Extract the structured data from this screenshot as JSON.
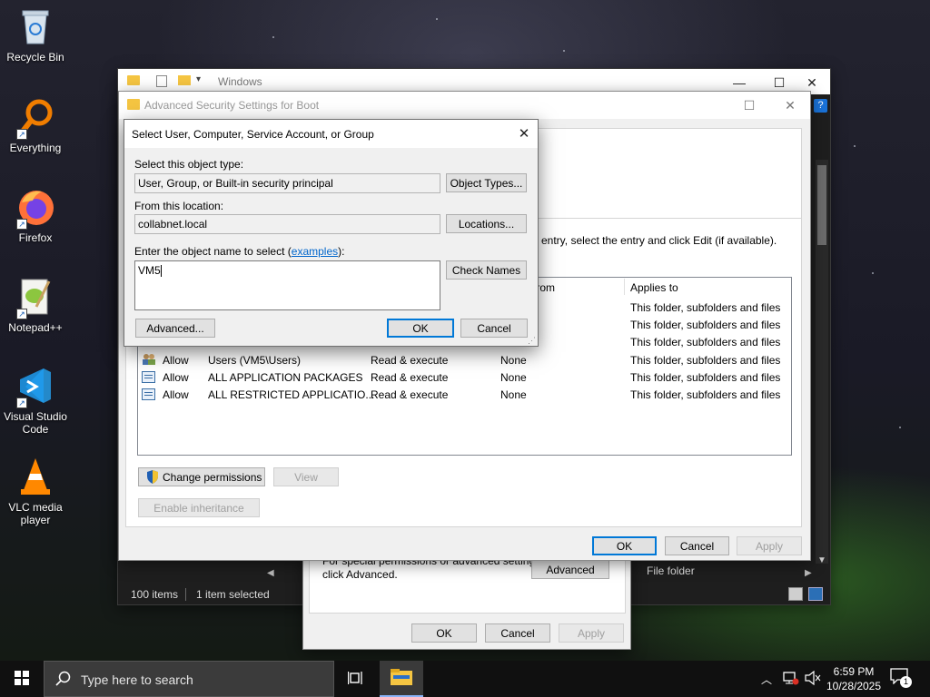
{
  "desktop": {
    "icons": [
      {
        "label": "Recycle Bin",
        "icon": "recycle-bin-icon"
      },
      {
        "label": "Everything",
        "icon": "search-magnifier-icon"
      },
      {
        "label": "Firefox",
        "icon": "firefox-icon"
      },
      {
        "label": "Notepad++",
        "icon": "notepad-plus-plus-icon"
      },
      {
        "label": "Visual Studio Code",
        "icon": "vscode-icon"
      },
      {
        "label": "VLC media player",
        "icon": "vlc-cone-icon"
      }
    ]
  },
  "explorer": {
    "title": "Windows",
    "status_items": "100 items",
    "status_selected": "1 item selected",
    "partial_file_type": "File folder"
  },
  "properties": {
    "partial_hint": "For special permissions or advanced settings,",
    "hint_line2": "click Advanced.",
    "advanced_label": "Advanced",
    "ok_label": "OK",
    "cancel_label": "Cancel",
    "apply_label": "Apply"
  },
  "advanced_security": {
    "title": "Advanced Security Settings for Boot",
    "partial_instruction": "entry, select the entry and click Edit (if available).",
    "columns": {
      "inherited_from": "d from",
      "applies_to": "Applies to"
    },
    "rows": [
      {
        "type": "",
        "principal": "",
        "access": "",
        "inherited": "",
        "applies": "This folder, subfolders and files"
      },
      {
        "type": "",
        "principal": "",
        "access": "",
        "inherited": "",
        "applies": "This folder, subfolders and files"
      },
      {
        "type": "",
        "principal": "",
        "access": "",
        "inherited": "",
        "applies": "This folder, subfolders and files"
      },
      {
        "type": "Allow",
        "principal": "Users (VM5\\Users)",
        "access": "Read & execute",
        "inherited": "None",
        "applies": "This folder, subfolders and files"
      },
      {
        "type": "Allow",
        "principal": "ALL APPLICATION PACKAGES",
        "access": "Read & execute",
        "inherited": "None",
        "applies": "This folder, subfolders and files"
      },
      {
        "type": "Allow",
        "principal": "ALL RESTRICTED APPLICATIO...",
        "access": "Read & execute",
        "inherited": "None",
        "applies": "This folder, subfolders and files"
      }
    ],
    "change_permissions_label": "Change permissions",
    "view_label": "View",
    "enable_inheritance_label": "Enable inheritance",
    "ok_label": "OK",
    "cancel_label": "Cancel",
    "apply_label": "Apply"
  },
  "select_dialog": {
    "title": "Select User, Computer, Service Account, or Group",
    "object_type_label": "Select this object type:",
    "object_type_value": "User, Group, or Built-in security principal",
    "object_types_button": "Object Types...",
    "location_label": "From this location:",
    "location_value": "collabnet.local",
    "locations_button": "Locations...",
    "name_label_prefix": "Enter the object name to select (",
    "name_label_link": "examples",
    "name_label_suffix": "):",
    "name_value": "VM5",
    "check_names_button": "Check Names",
    "advanced_button": "Advanced...",
    "ok_button": "OK",
    "cancel_button": "Cancel"
  },
  "taskbar": {
    "search_placeholder": "Type here to search",
    "time": "6:59 PM",
    "date": "10/28/2025",
    "notification_count": "1"
  },
  "colors": {
    "accent": "#0078d7",
    "link": "#0066cc",
    "taskbar": "#101010"
  }
}
